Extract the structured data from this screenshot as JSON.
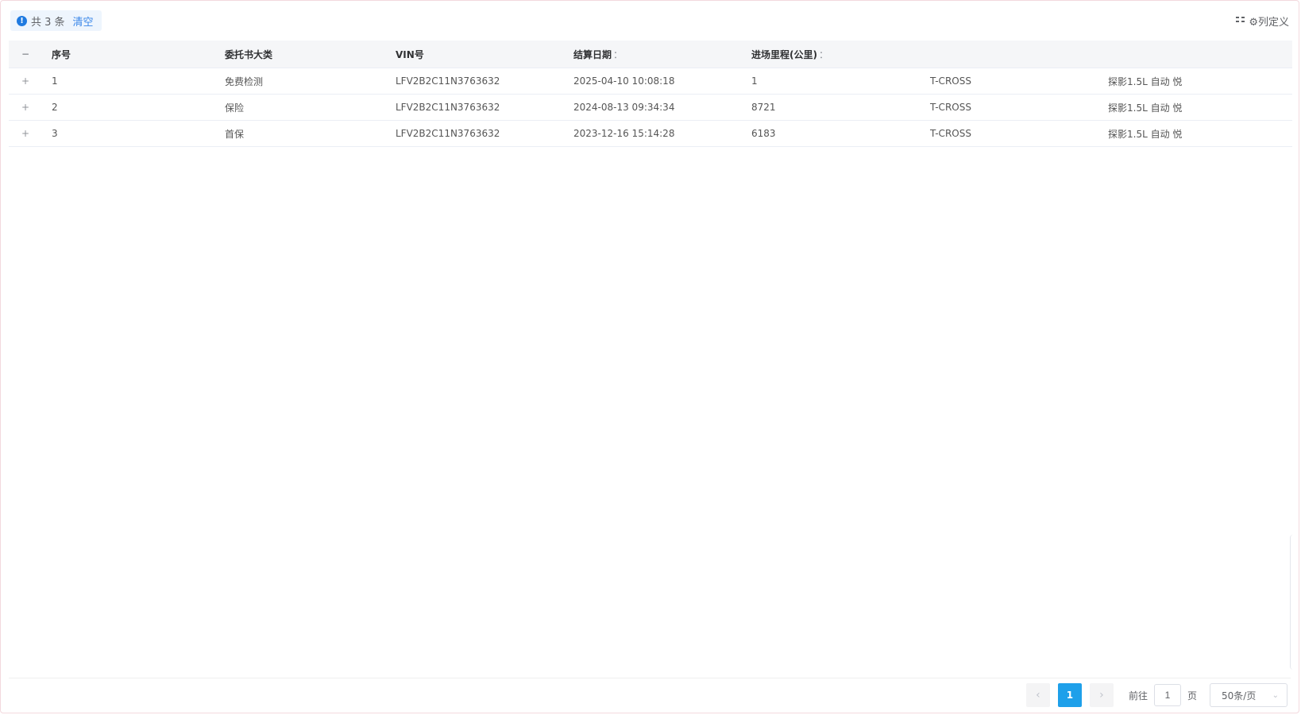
{
  "selection": {
    "info_icon": "info-icon",
    "count_text": "共 3 条",
    "clear_label": "清空"
  },
  "toolbar": {
    "columns_icon": "columns-icon",
    "column_def_label": "⚙列定义"
  },
  "table": {
    "columns": [
      {
        "label": "−",
        "filter": ""
      },
      {
        "label": "序号",
        "filter": ""
      },
      {
        "label": "委托书大类",
        "filter": ""
      },
      {
        "label": "VIN号",
        "filter": ""
      },
      {
        "label": "结算日期",
        "filter": "："
      },
      {
        "label": "进场里程(公里)",
        "filter": "："
      },
      {
        "label": "",
        "filter": ""
      },
      {
        "label": "",
        "filter": ""
      }
    ],
    "rows": [
      {
        "expand": "+",
        "no": "1",
        "category": "免费检测",
        "vin": "LFV2B2C11N3763632",
        "date": "2025-04-10 10:08:18",
        "mileage": "1",
        "model": "T-CROSS",
        "engine": "探影1.5L 自动 悦"
      },
      {
        "expand": "+",
        "no": "2",
        "category": "保险",
        "vin": "LFV2B2C11N3763632",
        "date": "2024-08-13 09:34:34",
        "mileage": "8721",
        "model": "T-CROSS",
        "engine": "探影1.5L 自动 悦"
      },
      {
        "expand": "+",
        "no": "3",
        "category": "首保",
        "vin": "LFV2B2C11N3763632",
        "date": "2023-12-16 15:14:28",
        "mileage": "6183",
        "model": "T-CROSS",
        "engine": "探影1.5L 自动 悦"
      }
    ]
  },
  "pagination": {
    "prev": "‹",
    "current_page": "1",
    "next": "›",
    "goto_label": "前往",
    "goto_value": "1",
    "page_unit": "页",
    "page_size": "50条/页",
    "chevron": "⌄"
  }
}
